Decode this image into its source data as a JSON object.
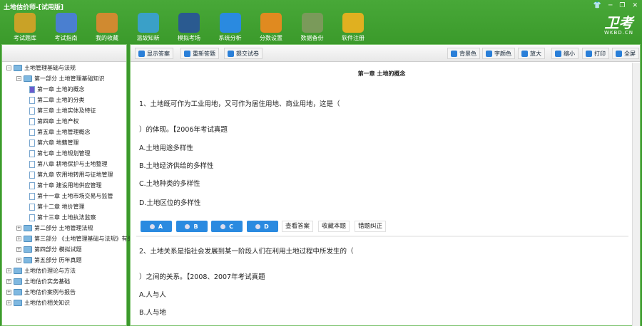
{
  "window": {
    "title": "土地估价师-[试用版]",
    "controls": [
      "skin",
      "minimize",
      "restore",
      "close"
    ]
  },
  "toolbar": [
    {
      "label": "考试题库",
      "icon": "book-star-icon",
      "color": "#c9a227"
    },
    {
      "label": "考试指南",
      "icon": "compass-icon",
      "color": "#4a7fd0"
    },
    {
      "label": "我的收藏",
      "icon": "gift-box-icon",
      "color": "#d08a30"
    },
    {
      "label": "温故知新",
      "icon": "cubes-icon",
      "color": "#3aa0c8"
    },
    {
      "label": "模拟考场",
      "icon": "monitor-user-icon",
      "color": "#2a5a90"
    },
    {
      "label": "系统分析",
      "icon": "pie-chart-icon",
      "color": "#2a8ae0"
    },
    {
      "label": "分数设置",
      "icon": "tools-icon",
      "color": "#e08a20"
    },
    {
      "label": "数据备份",
      "icon": "disk-icon",
      "color": "#7a9a5a"
    },
    {
      "label": "软件注册",
      "icon": "lock-key-icon",
      "color": "#e0b020"
    }
  ],
  "logo": {
    "main": "卫考",
    "sub": "WKBD.CN"
  },
  "tree": [
    {
      "label": "土地管理基础与法规",
      "level": 0,
      "type": "folder",
      "expanded": true
    },
    {
      "label": "第一部分  土地管理基础知识",
      "level": 1,
      "type": "folder",
      "expanded": true
    },
    {
      "label": "第一章  土地的概念",
      "level": 2,
      "type": "doc",
      "selected": true
    },
    {
      "label": "第二章  土地的分类",
      "level": 2,
      "type": "doc"
    },
    {
      "label": "第三章  土地实体及特征",
      "level": 2,
      "type": "doc"
    },
    {
      "label": "第四章  土地产权",
      "level": 2,
      "type": "doc"
    },
    {
      "label": "第五章  土地管理概念",
      "level": 2,
      "type": "doc"
    },
    {
      "label": "第六章  地籍管理",
      "level": 2,
      "type": "doc"
    },
    {
      "label": "第七章  土地规划管理",
      "level": 2,
      "type": "doc"
    },
    {
      "label": "第八章  耕地保护与土地整理",
      "level": 2,
      "type": "doc"
    },
    {
      "label": "第九章  农用地转用与征地管理",
      "level": 2,
      "type": "doc"
    },
    {
      "label": "第十章  建设用地供应管理",
      "level": 2,
      "type": "doc"
    },
    {
      "label": "第十一章  土地市场交易与监管",
      "level": 2,
      "type": "doc"
    },
    {
      "label": "第十二章  地价管理",
      "level": 2,
      "type": "doc"
    },
    {
      "label": "第十三章  土地执法监察",
      "level": 2,
      "type": "doc"
    },
    {
      "label": "第二部分  土地管理法规",
      "level": 1,
      "type": "folder"
    },
    {
      "label": "第三部分  《土地管理基础与法规》有关计",
      "level": 1,
      "type": "folder"
    },
    {
      "label": "第四部分  模拟试题",
      "level": 1,
      "type": "folder"
    },
    {
      "label": "第五部分  历年真题",
      "level": 1,
      "type": "folder"
    },
    {
      "label": "土地估价理论与方法",
      "level": 0,
      "type": "folder"
    },
    {
      "label": "土地估价实务基础",
      "level": 0,
      "type": "folder"
    },
    {
      "label": "土地估价案例与报告",
      "level": 0,
      "type": "folder"
    },
    {
      "label": "土地估价相关知识",
      "level": 0,
      "type": "folder"
    }
  ],
  "actions_left": [
    "显示答案",
    "重新答题",
    "提交试卷"
  ],
  "actions_right": [
    "背景色",
    "字颜色",
    "放大",
    "缩小",
    "打印",
    "全屏"
  ],
  "content": {
    "chapter": "第一章  土地的概念",
    "q1": {
      "line1": "1、土地既可作为工业用地，又可作为居住用地、商业用地，这是（",
      "line2": "）的体现。【2006年考试真题",
      "options": [
        "A.土地用途多样性",
        "B.土地经济供给的多样性",
        "C.土地种类的多样性",
        "D.土地区位的多样性"
      ]
    },
    "answer_buttons": [
      "A",
      "B",
      "C",
      "D"
    ],
    "q_actions": [
      "查看答案",
      "收藏本题",
      "错题纠正"
    ],
    "q2": {
      "line1": "2、土地关系是指社会发展到某一阶段人们在利用土地过程中所发生的（",
      "line2": "）之间的关系。【2008、2007年考试真题",
      "options": [
        "A.人与人",
        "B.人与地"
      ]
    }
  }
}
